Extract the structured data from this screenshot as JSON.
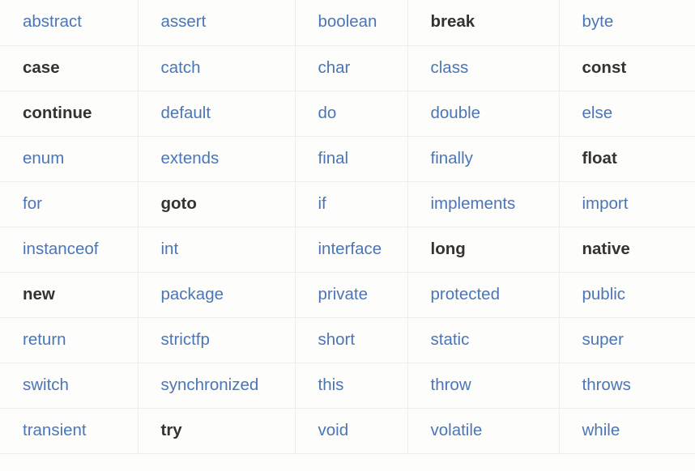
{
  "table": {
    "columns": 5,
    "rows": 10,
    "colors": {
      "link": "#4a76b8",
      "plain_text": "#36332f",
      "grid_line": "#eeeeee",
      "background": "#fdfdfb"
    },
    "cells": [
      [
        {
          "text": "abstract",
          "link": true
        },
        {
          "text": "assert",
          "link": true
        },
        {
          "text": "boolean",
          "link": true
        },
        {
          "text": "break",
          "link": false
        },
        {
          "text": "byte",
          "link": true
        }
      ],
      [
        {
          "text": "case",
          "link": false
        },
        {
          "text": "catch",
          "link": true
        },
        {
          "text": "char",
          "link": true
        },
        {
          "text": "class",
          "link": true
        },
        {
          "text": "const",
          "link": false
        }
      ],
      [
        {
          "text": "continue",
          "link": false
        },
        {
          "text": "default",
          "link": true
        },
        {
          "text": "do",
          "link": true
        },
        {
          "text": "double",
          "link": true
        },
        {
          "text": "else",
          "link": true
        }
      ],
      [
        {
          "text": "enum",
          "link": true
        },
        {
          "text": "extends",
          "link": true
        },
        {
          "text": "final",
          "link": true
        },
        {
          "text": "finally",
          "link": true
        },
        {
          "text": "float",
          "link": false
        }
      ],
      [
        {
          "text": "for",
          "link": true
        },
        {
          "text": "goto",
          "link": false
        },
        {
          "text": "if",
          "link": true
        },
        {
          "text": "implements",
          "link": true
        },
        {
          "text": "import",
          "link": true
        }
      ],
      [
        {
          "text": "instanceof",
          "link": true
        },
        {
          "text": "int",
          "link": true
        },
        {
          "text": "interface",
          "link": true
        },
        {
          "text": "long",
          "link": false
        },
        {
          "text": "native",
          "link": false
        }
      ],
      [
        {
          "text": "new",
          "link": false
        },
        {
          "text": "package",
          "link": true
        },
        {
          "text": "private",
          "link": true
        },
        {
          "text": "protected",
          "link": true
        },
        {
          "text": "public",
          "link": true
        }
      ],
      [
        {
          "text": "return",
          "link": true
        },
        {
          "text": "strictfp",
          "link": true
        },
        {
          "text": "short",
          "link": true
        },
        {
          "text": "static",
          "link": true
        },
        {
          "text": "super",
          "link": true
        }
      ],
      [
        {
          "text": "switch",
          "link": true
        },
        {
          "text": "synchronized",
          "link": true
        },
        {
          "text": "this",
          "link": true
        },
        {
          "text": "throw",
          "link": true
        },
        {
          "text": "throws",
          "link": true
        }
      ],
      [
        {
          "text": "transient",
          "link": true
        },
        {
          "text": "try",
          "link": false
        },
        {
          "text": "void",
          "link": true
        },
        {
          "text": "volatile",
          "link": true
        },
        {
          "text": "while",
          "link": true
        }
      ]
    ]
  }
}
